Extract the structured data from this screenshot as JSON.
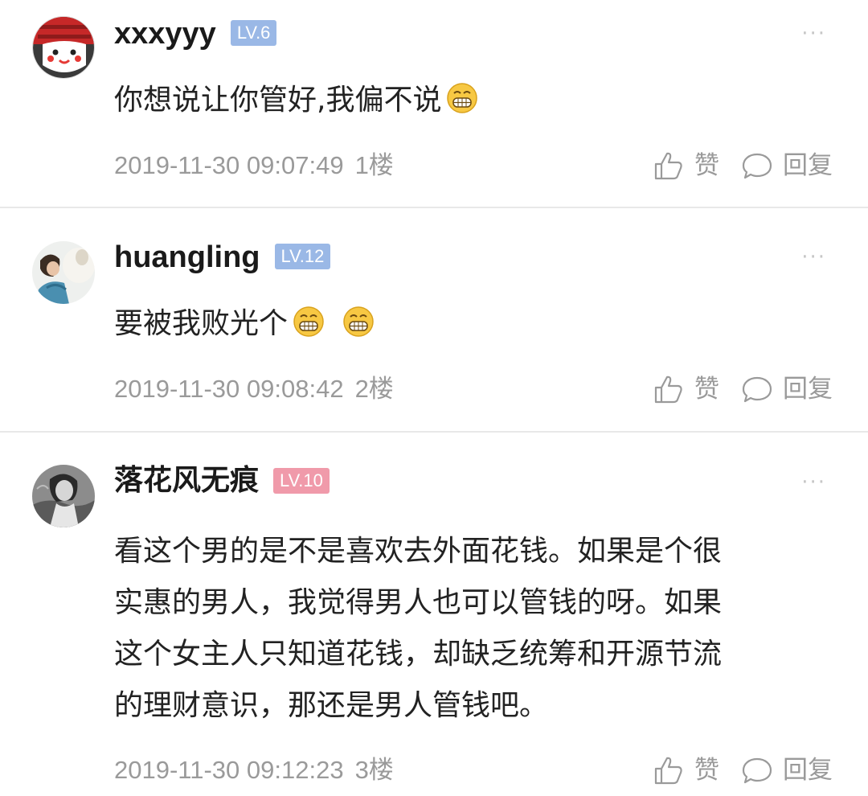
{
  "comments": [
    {
      "username": "xxxyyy",
      "level": "LV.6",
      "level_color": "#9ab8e6",
      "text": "你想说让你管好,我偏不说",
      "emoji_count": 1,
      "time": "2019-11-30 09:07:49",
      "floor": "1楼",
      "like_label": "赞",
      "reply_label": "回复",
      "more": "···"
    },
    {
      "username": "huangling",
      "level": "LV.12",
      "level_color": "#9ab8e6",
      "text": "要被我败光个",
      "emoji_count": 2,
      "time": "2019-11-30 09:08:42",
      "floor": "2楼",
      "like_label": "赞",
      "reply_label": "回复",
      "more": "···"
    },
    {
      "username": "落花风无痕",
      "level": "LV.10",
      "level_color": "#f09aaa",
      "text_lines": [
        "看这个男的是不是喜欢去外面花钱。如果是个很",
        "实惠的男人，我觉得男人也可以管钱的呀。如果",
        "这个女主人只知道花钱，却缺乏统筹和开源节流",
        "的理财意识，那还是男人管钱吧。"
      ],
      "time": "2019-11-30 09:12:23",
      "floor": "3楼",
      "like_label": "赞",
      "reply_label": "回复",
      "more": "···"
    }
  ],
  "emoji_name": "grin-emoji"
}
